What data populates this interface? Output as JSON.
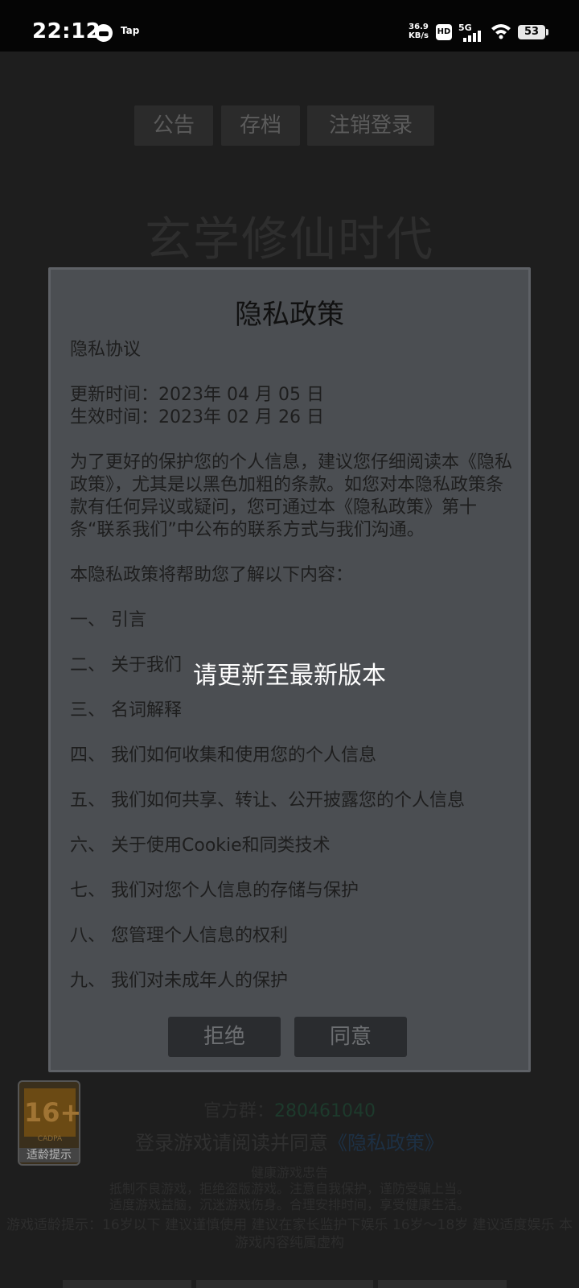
{
  "status_bar": {
    "time": "22:12",
    "app_icon_2": "Tap",
    "speed_value": "36.9",
    "speed_unit": "KB/s",
    "hd": "HD",
    "network": "5G",
    "battery": "53"
  },
  "background": {
    "buttons": [
      "公告",
      "存档",
      "注销登录"
    ],
    "game_title": "玄学修仙时代",
    "official_label": "官方群：",
    "official_qq": "280461040",
    "login_prefix": "登录游戏请阅读并同意",
    "login_link": "《隐私政策》",
    "health_title": "健康游戏忠告",
    "health_lines": [
      "抵制不良游戏，拒绝盗版游戏。注意自我保护，谨防受骗上当。",
      "适度游戏益脑，沉迷游戏伤身。合理安排时间，享受健康生活。"
    ],
    "age_tip": "游戏适龄提示：16岁以下 建议谨慎使用 建议在家长监护下娱乐 16岁～18岁 建议适度娱乐 本游戏内容纯属虚构",
    "age_badge": {
      "rating": "16+",
      "org": "CADPA",
      "hint": "适龄提示"
    }
  },
  "dialog": {
    "title": "隐私政策",
    "heading": "隐私协议",
    "updated": "更新时间：2023年 04 月 05 日",
    "effective": "生效时间：2023年 02 月 26 日",
    "intro": "为了更好的保护您的个人信息，建议您仔细阅读本《隐私政策》，尤其是以黑色加粗的条款。如您对本隐私政策条款有任何异议或疑问，您可通过本《隐私政策》第十条“联系我们”中公布的联系方式与我们沟通。",
    "summary": "本隐私政策将帮助您了解以下内容：",
    "items": [
      "一、 引言",
      "二、 关于我们",
      "三、 名词解释",
      "四、 我们如何收集和使用您的个人信息",
      "五、 我们如何共享、转让、公开披露您的个人信息",
      "六、 关于使用Cookie和同类技术",
      "七、 我们对您个人信息的存储与保护",
      "八、 您管理个人信息的权利",
      "九、 我们对未成年人的保护"
    ],
    "reject": "拒绝",
    "agree": "同意"
  },
  "toast": "请更新至最新版本"
}
